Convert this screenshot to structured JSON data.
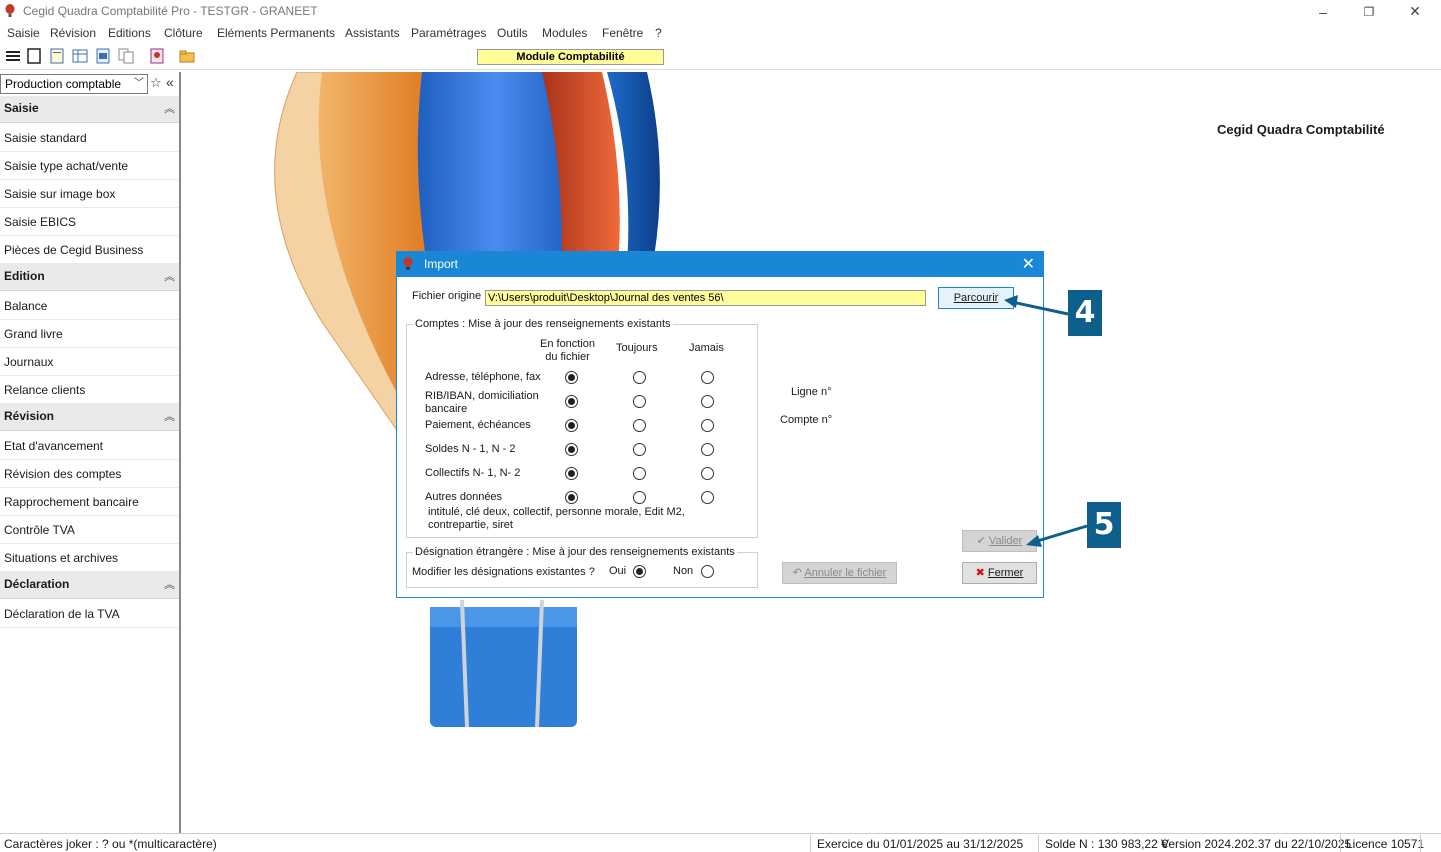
{
  "window": {
    "title": "Cegid Quadra Comptabilité Pro - TESTGR - GRANEET",
    "minimize": "–",
    "restore": "❐",
    "close": "✕"
  },
  "menu": [
    "Saisie",
    "Révision",
    "Editions",
    "Clôture",
    "Eléments Permanents",
    "Assistants",
    "Paramétrages",
    "Outils",
    "Modules",
    "Fenêtre",
    "?"
  ],
  "toolbar": {
    "module_label": "Module Comptabilité"
  },
  "sidebar": {
    "combo_value": "Production comptable",
    "sections": [
      {
        "title": "Saisie",
        "items": [
          "Saisie standard",
          "Saisie type achat/vente",
          "Saisie sur image box",
          "Saisie EBICS",
          "Pièces de Cegid Business"
        ]
      },
      {
        "title": "Edition",
        "items": [
          "Balance",
          "Grand livre",
          "Journaux",
          "Relance clients"
        ]
      },
      {
        "title": "Révision",
        "items": [
          "Etat d'avancement",
          "Révision des comptes",
          "Rapprochement bancaire",
          "Contrôle TVA",
          "Situations et archives"
        ]
      },
      {
        "title": "Déclaration",
        "items": [
          "Déclaration de la TVA"
        ]
      }
    ]
  },
  "main": {
    "brand": "Cegid Quadra Comptabilité"
  },
  "dialog": {
    "title": "Import",
    "fichier_label": "Fichier origine",
    "fichier_value": "V:\\Users\\produit\\Desktop\\Journal des ventes 56\\",
    "browse_button": "Parcourir",
    "comptes_group": "Comptes : Mise à jour des renseignements existants",
    "col_headers": [
      "En fonction\ndu fichier",
      "Toujours",
      "Jamais"
    ],
    "rows": [
      {
        "label": "Adresse, téléphone, fax",
        "selected": 0
      },
      {
        "label": "RIB/IBAN, domiciliation\nbancaire",
        "selected": 0
      },
      {
        "label": "Paiement, échéances",
        "selected": 0
      },
      {
        "label": "Soldes N - 1, N - 2",
        "selected": 0
      },
      {
        "label": "Collectifs N- 1, N- 2",
        "selected": 0
      },
      {
        "label": "Autres données",
        "selected": 0
      }
    ],
    "autres_detail": "intitulé, clé deux, collectif, personne morale, Edit M2,\ncontrepartie, siret",
    "ligne_label": "Ligne n°",
    "compte_label": "Compte n°",
    "designation_group": "Désignation étrangère : Mise à jour des renseignements existants",
    "designation_question": "Modifier les désignations existantes ?",
    "oui": "Oui",
    "non": "Non",
    "designation_selected": "oui",
    "valider_button": "Valider",
    "annuler_button": "Annuler le fichier",
    "fermer_button": "Fermer"
  },
  "callouts": [
    "4",
    "5"
  ],
  "status": {
    "left": "Caractères joker : ? ou *(multicaractère)",
    "exercice": "Exercice du 01/01/2025 au 31/12/2025",
    "solde": "Solde N : 130 983,22 €",
    "version": "Version 2024.202.37 du 22/10/2025",
    "licence": "Licence 10571"
  },
  "colors": {
    "accent": "#1a86d6",
    "highlight": "#fffc9a",
    "callout": "#0d5f8c"
  }
}
